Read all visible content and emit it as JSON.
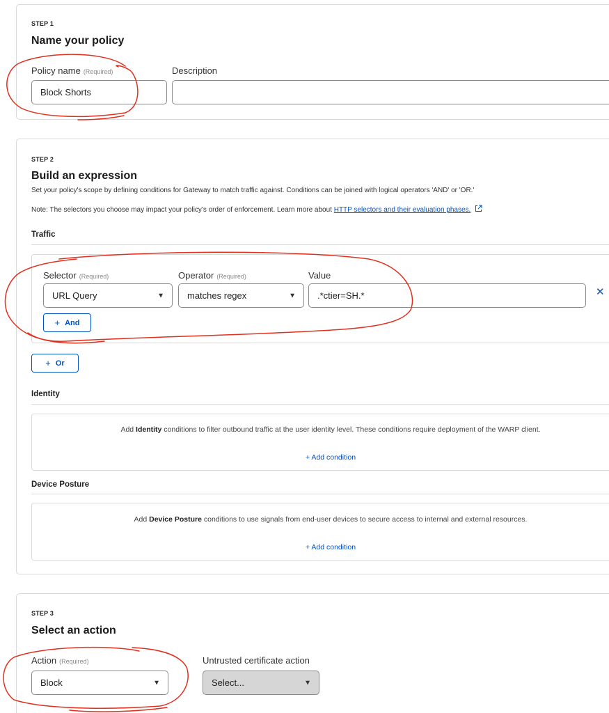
{
  "step1": {
    "step_label": "STEP 1",
    "title": "Name your policy",
    "policy_name_label": "Policy name",
    "required_tag": "(Required)",
    "policy_name_value": "Block Shorts",
    "description_label": "Description",
    "description_value": ""
  },
  "step2": {
    "step_label": "STEP 2",
    "title": "Build an expression",
    "description": "Set your policy's scope by defining conditions for Gateway to match traffic against. Conditions can be joined with logical operators 'AND' or 'OR.'",
    "note_prefix": "Note: The selectors you choose may impact your policy's order of enforcement. Learn more about ",
    "note_link": "HTTP selectors and their evaluation phases.",
    "traffic": {
      "title": "Traffic",
      "selector_label": "Selector",
      "operator_label": "Operator",
      "value_label": "Value",
      "required_tag": "(Required)",
      "selector_value": "URL Query",
      "operator_value": "matches regex",
      "value_value": ".*ctier=SH.*",
      "and_label": "And",
      "or_label": "Or",
      "remove_icon": "close-icon"
    },
    "identity": {
      "title": "Identity",
      "text_prefix": "Add ",
      "text_bold": "Identity",
      "text_suffix": " conditions to filter outbound traffic at the user identity level. These conditions require deployment of the WARP client.",
      "add_label": "+ Add condition"
    },
    "device_posture": {
      "title": "Device Posture",
      "text_prefix": "Add ",
      "text_bold": "Device Posture",
      "text_suffix": " conditions to use signals from end-user devices to secure access to internal and external resources.",
      "add_label": "+ Add condition"
    }
  },
  "step3": {
    "step_label": "STEP 3",
    "title": "Select an action",
    "action_label": "Action",
    "required_tag": "(Required)",
    "action_value": "Block",
    "cert_label": "Untrusted certificate action",
    "cert_placeholder": "Select..."
  },
  "colors": {
    "link_blue": "#0051c3",
    "annotation_red": "#e0301e",
    "border_gray": "#d9d9d9"
  }
}
